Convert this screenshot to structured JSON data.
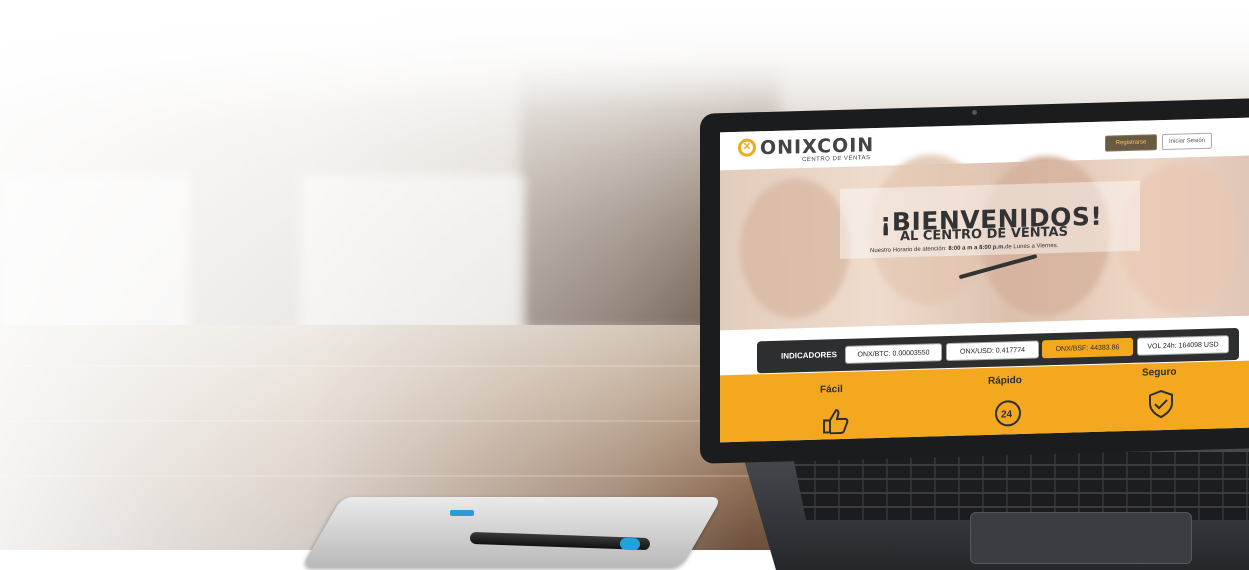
{
  "site": {
    "logo_text": "ONIXCOIN",
    "logo_sub": "CENTRO DE VENTAS",
    "register_label": "Registrarse",
    "login_label": "Iniciar Sesión"
  },
  "hero": {
    "title": "¡BIENVENIDOS!",
    "subtitle": "AL CENTRO DE VENTAS",
    "hours_prefix": "Nuestro Horario de atención:",
    "hours_value": "8:00 a m a 8:00 p.m.",
    "hours_suffix": "de Lunes a Viernes."
  },
  "indicators": {
    "label": "INDICADORES",
    "items": [
      {
        "text": "ONX/BTC: 0.00003550"
      },
      {
        "text": "ONX/USD: 0.417774"
      },
      {
        "text": "ONX/BSF: 44383.86"
      },
      {
        "text": "VOL 24h: 164098 USD"
      }
    ]
  },
  "features": {
    "items": [
      {
        "title": "Fácil",
        "icon": "thumbs-up-icon"
      },
      {
        "title": "Rápido",
        "icon": "24h-clock-icon"
      },
      {
        "title": "Seguro",
        "icon": "shield-check-icon"
      }
    ]
  },
  "colors": {
    "accent": "#f3a81f",
    "dark": "#2d2e30",
    "register_text": "#f7c45a"
  }
}
